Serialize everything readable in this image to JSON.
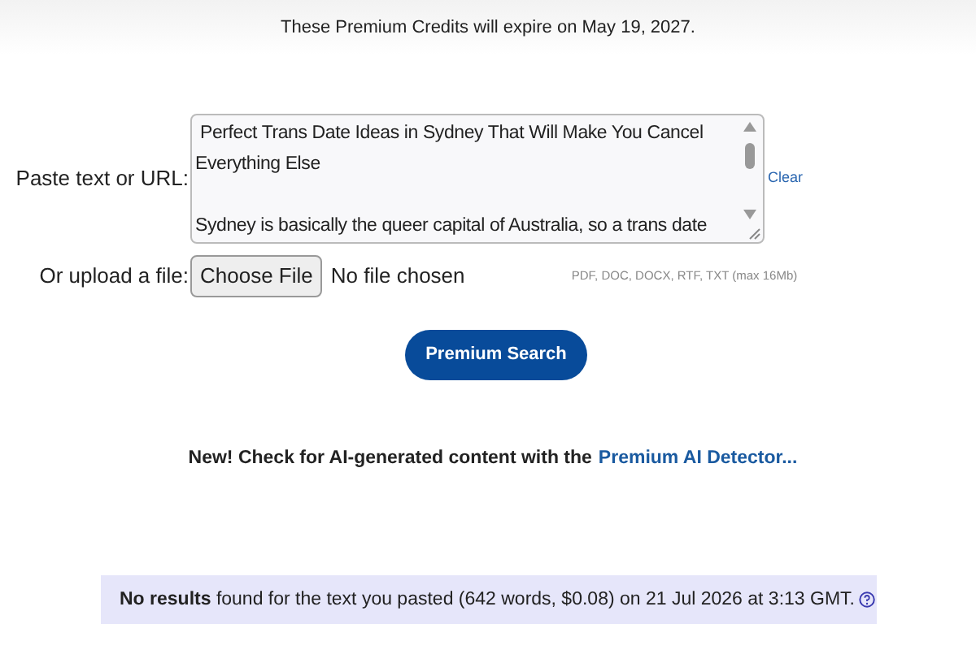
{
  "notice": "These Premium Credits will expire on May 19, 2027.",
  "paste": {
    "label": "Paste text or URL:",
    "value": " Perfect Trans Date Ideas in Sydney That Will Make You Cancel Everything Else\n\nSydney is basically the queer capital of Australia, so a trans date",
    "clear": "Clear"
  },
  "upload": {
    "label": "Or upload a file:",
    "button": "Choose File",
    "status": "No file chosen",
    "hint": "PDF, DOC, DOCX, RTF, TXT (max 16Mb)"
  },
  "search_button": "Premium Search",
  "promo": {
    "text": "New! Check for AI-generated content with the",
    "link": "Premium AI Detector..."
  },
  "result": "**No results** found for the text you pasted (642 words, $0.08) on 21 Jul 2026 at 3:13 GMT."
}
